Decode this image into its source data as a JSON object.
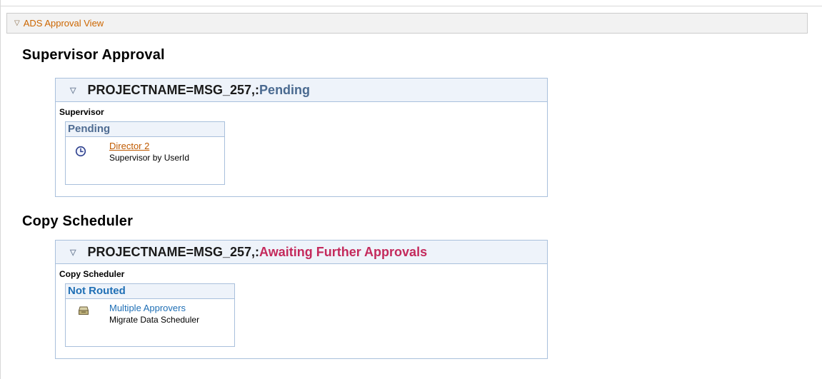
{
  "page": {
    "section_title": "ADS Approval View"
  },
  "stages": [
    {
      "heading": "Supervisor Approval",
      "path_name": "PROJECTNAME=MSG_257,:",
      "path_status": "Pending",
      "step_label": "Supervisor",
      "approver": {
        "status": "Pending",
        "name": "Director 2",
        "description": "Supervisor by UserId",
        "icon": "clock-icon"
      }
    },
    {
      "heading": "Copy Scheduler",
      "path_name": "PROJECTNAME=MSG_257,:",
      "path_status": "Awaiting Further Approvals",
      "step_label": "Copy Scheduler",
      "approver": {
        "status": "Not Routed",
        "name": "Multiple Approvers",
        "description": "Migrate Data Scheduler",
        "icon": "inbox-tray-icon"
      }
    }
  ],
  "colors": {
    "link_orange": "#c05a00",
    "pending_status": "#4a6a90",
    "awaiting_status": "#c42a5c",
    "not_routed": "#1f6fb5"
  }
}
